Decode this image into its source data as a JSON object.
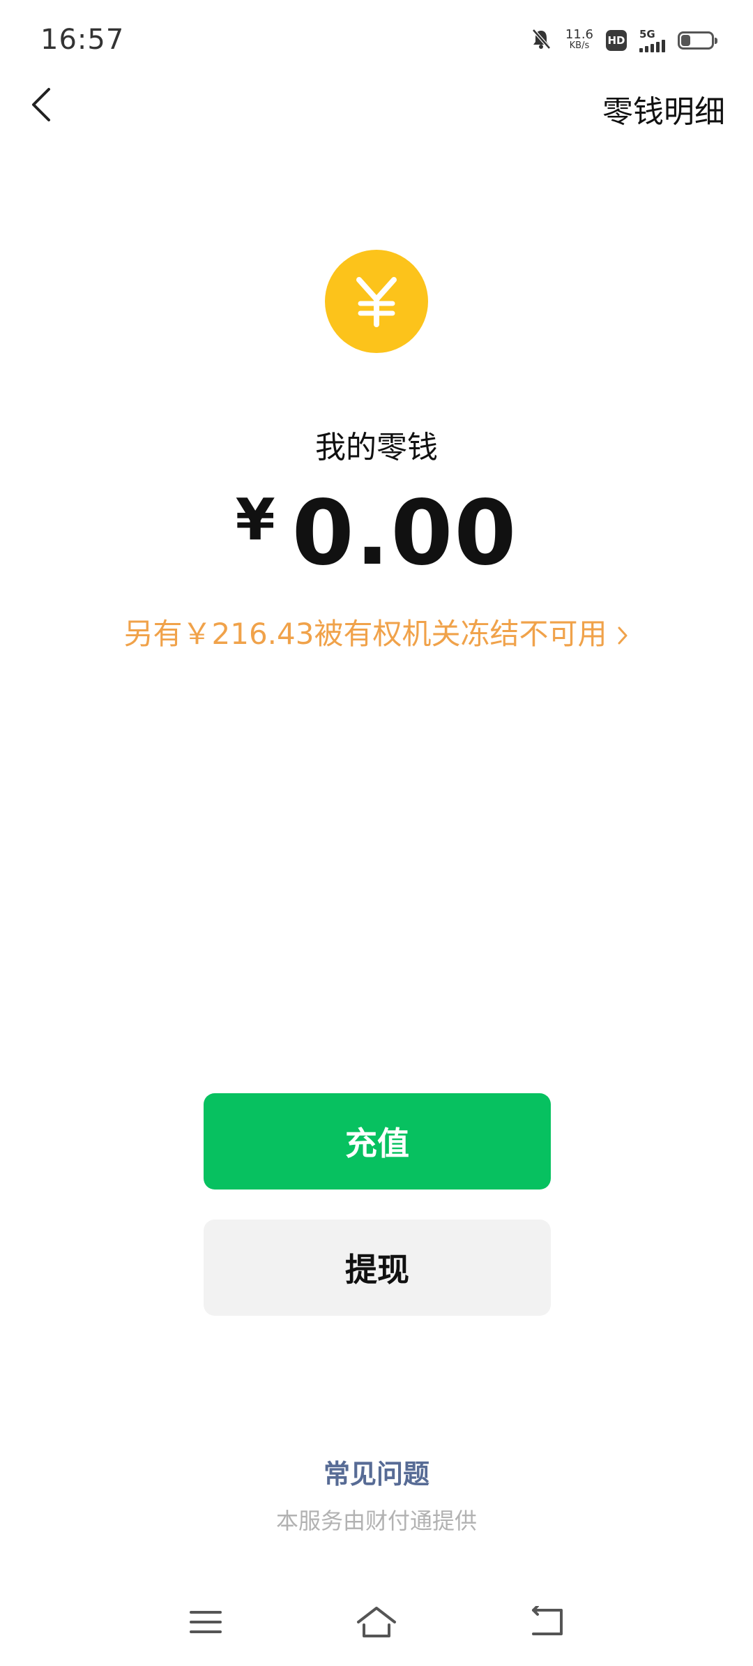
{
  "status_bar": {
    "time": "16:57",
    "net_speed_value": "11.6",
    "net_speed_unit": "KB/s",
    "hd_label": "HD",
    "network_label": "5G",
    "battery_level": 0.3,
    "icons": [
      "mute-bell-icon",
      "hd-icon",
      "signal-icon",
      "battery-icon"
    ]
  },
  "nav": {
    "back_icon": "chevron-left-icon",
    "detail_label": "零钱明细"
  },
  "wallet": {
    "coin_symbol": "¥",
    "coin_color": "#fcc31b",
    "title": "我的零钱",
    "currency_symbol": "¥",
    "balance": "0.00",
    "frozen_note": "另有￥216.43被有权机关冻结不可用",
    "frozen_color": "#f0a24a"
  },
  "actions": {
    "recharge_label": "充值",
    "recharge_color": "#07c160",
    "withdraw_label": "提现"
  },
  "footer": {
    "faq_label": "常见问题",
    "provider_text": "本服务由财付通提供"
  },
  "system_nav": {
    "icons": [
      "menu-icon",
      "home-icon",
      "back-icon"
    ]
  }
}
